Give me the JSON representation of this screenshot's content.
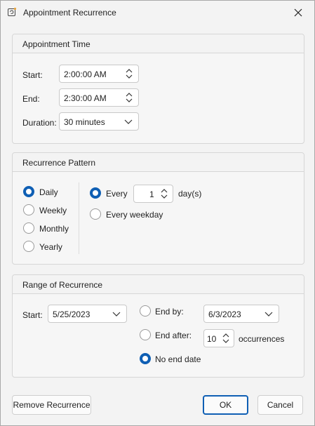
{
  "window": {
    "title": "Appointment Recurrence",
    "icon": "recurrence-icon",
    "close_icon": "close-icon"
  },
  "appointment_time": {
    "title": "Appointment Time",
    "start_label": "Start:",
    "start_value": "2:00:00 AM",
    "end_label": "End:",
    "end_value": "2:30:00 AM",
    "duration_label": "Duration:",
    "duration_value": "30 minutes"
  },
  "recurrence_pattern": {
    "title": "Recurrence Pattern",
    "frequencies": [
      {
        "label": "Daily",
        "selected": true
      },
      {
        "label": "Weekly",
        "selected": false
      },
      {
        "label": "Monthly",
        "selected": false
      },
      {
        "label": "Yearly",
        "selected": false
      }
    ],
    "every_label": "Every",
    "every_value": "1",
    "every_unit": "day(s)",
    "every_selected": true,
    "weekday_label": "Every weekday",
    "weekday_selected": false
  },
  "range": {
    "title": "Range of Recurrence",
    "start_label": "Start:",
    "start_value": "5/25/2023",
    "end_by_label": "End by:",
    "end_by_value": "6/3/2023",
    "end_after_label": "End after:",
    "end_after_value": "10",
    "occurrences_label": "occurrences",
    "no_end_label": "No end date",
    "selected": "no_end"
  },
  "buttons": {
    "remove": "Remove Recurrence",
    "ok": "OK",
    "cancel": "Cancel"
  },
  "colors": {
    "accent": "#0f5fb4",
    "icon_dot": "#e8a33b"
  }
}
